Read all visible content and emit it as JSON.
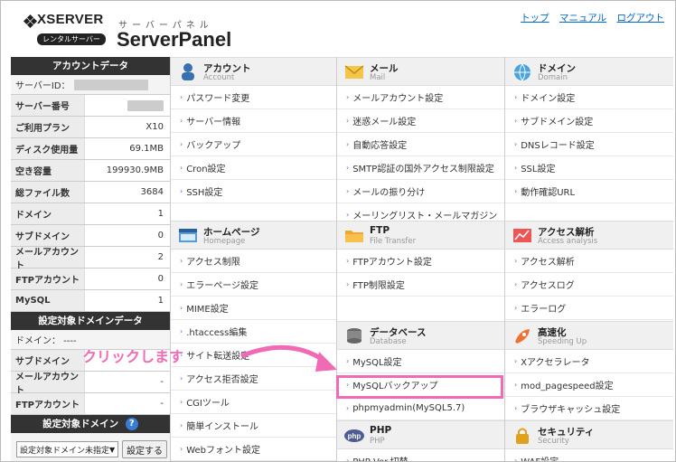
{
  "header": {
    "brand": "XSERVER",
    "brand_sub": "レンタルサーバー",
    "panel_kana": "サーバーパネル",
    "panel_title": "ServerPanel",
    "links": [
      "トップ",
      "マニュアル",
      "ログアウト"
    ]
  },
  "sidebar": {
    "account_title": "アカウントデータ",
    "server_id_label": "サーバーID：",
    "rows": [
      {
        "key": "サーバー番号",
        "value": ""
      },
      {
        "key": "ご利用プラン",
        "value": "X10"
      },
      {
        "key": "ディスク使用量",
        "value": "69.1MB"
      },
      {
        "key": "空き容量",
        "value": "199930.9MB"
      },
      {
        "key": "総ファイル数",
        "value": "3684"
      },
      {
        "key": "ドメイン",
        "value": "1"
      },
      {
        "key": "サブドメイン",
        "value": "0"
      },
      {
        "key": "メールアカウント",
        "value": "2"
      },
      {
        "key": "FTPアカウント",
        "value": "0"
      },
      {
        "key": "MySQL",
        "value": "1"
      }
    ],
    "domain_data_title": "設定対象ドメインデータ",
    "domain_line": "ドメイン：  ----",
    "domain_rows": [
      {
        "key": "サブドメイン",
        "value": "-"
      },
      {
        "key": "メールアカウント",
        "value": "-"
      },
      {
        "key": "FTPアカウント",
        "value": "-"
      }
    ],
    "target_domain_title": "設定対象ドメイン",
    "help_icon": "?",
    "select_value": "設定対象ドメイン未指定",
    "set_button": "設定する"
  },
  "columns": [
    {
      "sections": [
        {
          "title": "アカウント",
          "subtitle": "Account",
          "icon": "person-icon",
          "items": [
            "パスワード変更",
            "サーバー情報",
            "バックアップ",
            "Cron設定",
            "SSH設定"
          ]
        },
        {
          "title": "ホームページ",
          "subtitle": "Homepage",
          "icon": "window-icon",
          "items": [
            "アクセス制限",
            "エラーページ設定",
            "MIME設定",
            ".htaccess編集",
            "サイト転送設定",
            "アクセス拒否設定",
            "CGIツール",
            "簡単インストール",
            "Webフォント設定"
          ]
        }
      ]
    },
    {
      "sections": [
        {
          "title": "メール",
          "subtitle": "Mail",
          "icon": "envelope-icon",
          "items": [
            "メールアカウント設定",
            "迷惑メール設定",
            "自動応答設定",
            "SMTP認証の国外アクセス制限設定",
            "メールの振り分け",
            "メーリングリスト・メールマガジン"
          ]
        },
        {
          "title": "FTP",
          "subtitle": "File Transfer",
          "icon": "folder-icon",
          "items": [
            "FTPアカウント設定",
            "FTP制限設定"
          ]
        },
        {
          "title": "データベース",
          "subtitle": "Database",
          "icon": "database-icon",
          "items": [
            "MySQL設定",
            "MySQLバックアップ",
            "phpmyadmin(MySQL5.7)"
          ]
        },
        {
          "title": "PHP",
          "subtitle": "PHP",
          "icon": "php-icon",
          "items": [
            "PHP Ver.切替"
          ]
        }
      ]
    },
    {
      "sections": [
        {
          "title": "ドメイン",
          "subtitle": "Domain",
          "icon": "globe-icon",
          "items": [
            "ドメイン設定",
            "サブドメイン設定",
            "DNSレコード設定",
            "SSL設定",
            "動作確認URL"
          ]
        },
        {
          "title": "アクセス解析",
          "subtitle": "Access analysis",
          "icon": "chart-icon",
          "items": [
            "アクセス解析",
            "アクセスログ",
            "エラーログ"
          ]
        },
        {
          "title": "高速化",
          "subtitle": "Speeding Up",
          "icon": "rocket-icon",
          "items": [
            "Xアクセラレータ",
            "mod_pagespeed設定",
            "ブラウザキャッシュ設定"
          ]
        },
        {
          "title": "セキュリティ",
          "subtitle": "Security",
          "icon": "lock-icon",
          "items": [
            "WAF設定"
          ]
        }
      ]
    }
  ],
  "callout": "クリックします",
  "colors": {
    "accent_pink": "#f06ab5",
    "link_blue": "#0066cc",
    "sidebar_dark": "#333333"
  }
}
